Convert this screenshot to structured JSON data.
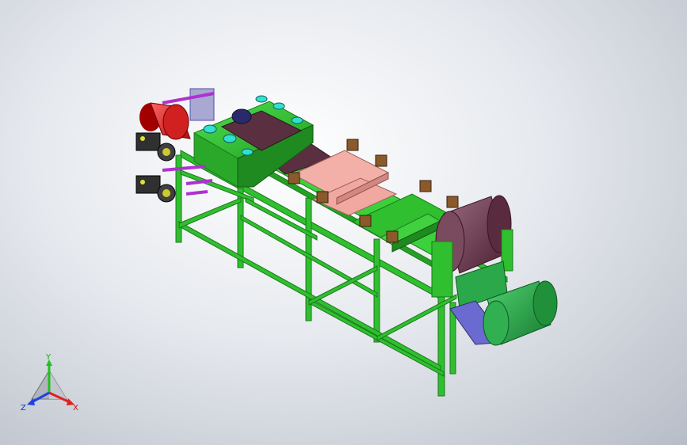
{
  "viewport": {
    "background_top": "#ffffff",
    "background_bottom": "#b7bdc7"
  },
  "colors": {
    "frame_green": "#2fbf2f",
    "frame_green_dark": "#1f8a1f",
    "roller_red": "#e82020",
    "roller_maroon": "#6e3a4e",
    "roller_green": "#2aa84a",
    "pink_pad": "#f0a8a0",
    "brown_block": "#8a5a2a",
    "purple_rod": "#b030d0",
    "blue_bracket": "#6a6ad0",
    "belt_dark": "#5a3040",
    "motor_dark": "#303030"
  },
  "triad": {
    "axis_y": "Y",
    "axis_x": "X",
    "axis_z": "Z",
    "color_x": "#e02020",
    "color_y": "#20c020",
    "color_z": "#2040e0"
  }
}
